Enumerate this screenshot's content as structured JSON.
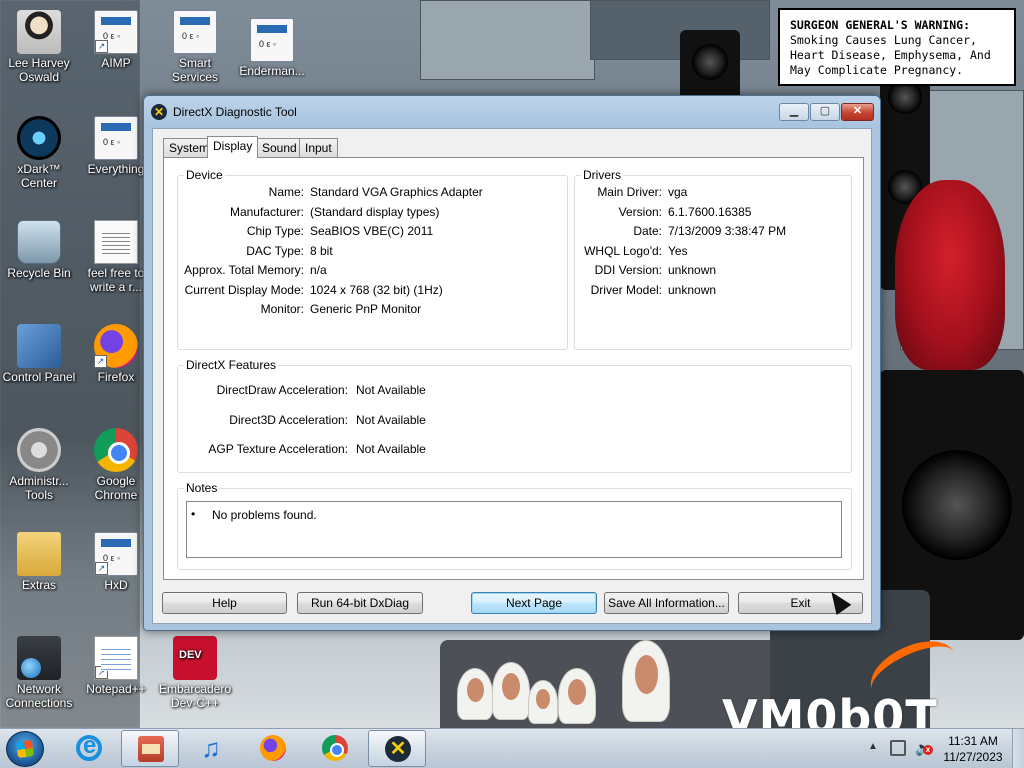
{
  "desktop": {
    "warning": {
      "prefix": "SURGEON GENERAL'S WARNING:",
      "body": "Smoking Causes Lung Cancer, Heart Disease, Emphysema, And May Complicate Pregnancy."
    },
    "watermark": "VM0b0T",
    "icons": [
      {
        "label": "Lee Harvey Oswald",
        "icon": "avatar-icon"
      },
      {
        "label": "AIMP",
        "icon": "aimp-icon"
      },
      {
        "label": "Smart Services",
        "icon": "gear-icon"
      },
      {
        "label": "Enderman...",
        "icon": "app-icon"
      },
      {
        "label": "xDark™ Center",
        "icon": "xdark-icon"
      },
      {
        "label": "Everything",
        "icon": "everything-icon"
      },
      {
        "label": "Recycle Bin",
        "icon": "recycle-bin-icon"
      },
      {
        "label": "feel free to write a r...",
        "icon": "document-icon"
      },
      {
        "label": "Control Panel",
        "icon": "control-panel-icon"
      },
      {
        "label": "Firefox",
        "icon": "firefox-icon"
      },
      {
        "label": "Administr... Tools",
        "icon": "admin-tools-icon"
      },
      {
        "label": "Google Chrome",
        "icon": "chrome-icon"
      },
      {
        "label": "Extras",
        "icon": "folder-icon"
      },
      {
        "label": "HxD",
        "icon": "hxd-icon"
      },
      {
        "label": "Network Connections",
        "icon": "network-icon"
      },
      {
        "label": "Notepad++",
        "icon": "notepad-icon"
      },
      {
        "label": "Embarcadero Dev-C++",
        "icon": "devcpp-icon"
      }
    ]
  },
  "window": {
    "title": "DirectX Diagnostic Tool",
    "controls": {
      "minimize": "▁",
      "maximize": "▢",
      "close": "✕"
    },
    "tabs": [
      {
        "label": "System",
        "active": false
      },
      {
        "label": "Display",
        "active": true
      },
      {
        "label": "Sound",
        "active": false
      },
      {
        "label": "Input",
        "active": false
      }
    ],
    "device": {
      "title": "Device",
      "rows": [
        {
          "label": "Name:",
          "value": "Standard VGA Graphics Adapter"
        },
        {
          "label": "Manufacturer:",
          "value": "(Standard display types)"
        },
        {
          "label": "Chip Type:",
          "value": "SeaBIOS VBE(C) 2011"
        },
        {
          "label": "DAC Type:",
          "value": "8 bit"
        },
        {
          "label": "Approx. Total Memory:",
          "value": "n/a"
        },
        {
          "label": "Current Display Mode:",
          "value": "1024 x 768 (32 bit) (1Hz)"
        },
        {
          "label": "Monitor:",
          "value": "Generic PnP Monitor"
        }
      ]
    },
    "drivers": {
      "title": "Drivers",
      "rows": [
        {
          "label": "Main Driver:",
          "value": "vga"
        },
        {
          "label": "Version:",
          "value": "6.1.7600.16385"
        },
        {
          "label": "Date:",
          "value": "7/13/2009 3:38:47 PM"
        },
        {
          "label": "WHQL Logo'd:",
          "value": "Yes"
        },
        {
          "label": "DDI Version:",
          "value": "unknown"
        },
        {
          "label": "Driver Model:",
          "value": "unknown"
        }
      ]
    },
    "features": {
      "title": "DirectX Features",
      "rows": [
        {
          "label": "DirectDraw Acceleration:",
          "value": "Not Available"
        },
        {
          "label": "Direct3D Acceleration:",
          "value": "Not Available"
        },
        {
          "label": "AGP Texture Acceleration:",
          "value": "Not Available"
        }
      ]
    },
    "notes": {
      "title": "Notes",
      "bullet": "•",
      "items": [
        "No problems found."
      ]
    },
    "buttons": {
      "help": "Help",
      "run64": "Run 64-bit DxDiag",
      "next": "Next Page",
      "save": "Save All Information...",
      "exit": "Exit"
    }
  },
  "taskbar": {
    "pinned": [
      {
        "name": "internet-explorer",
        "icon": "ie-icon"
      },
      {
        "name": "app",
        "icon": "app-icon"
      },
      {
        "name": "music",
        "icon": "music-icon"
      },
      {
        "name": "firefox",
        "icon": "firefox-icon"
      },
      {
        "name": "chrome",
        "icon": "chrome-icon"
      },
      {
        "name": "directx",
        "icon": "directx-icon",
        "active": true
      }
    ],
    "tray": {
      "arrow": "▲",
      "speaker": "🔈",
      "mute": "x"
    },
    "clock": {
      "time": "11:31 AM",
      "date": "11/27/2023"
    }
  },
  "colors": {
    "title_gradient_top": "#bcd3ea",
    "close_button": "#c44431",
    "default_button": "#bee6fd",
    "vm_accent": "#ff6a00"
  }
}
